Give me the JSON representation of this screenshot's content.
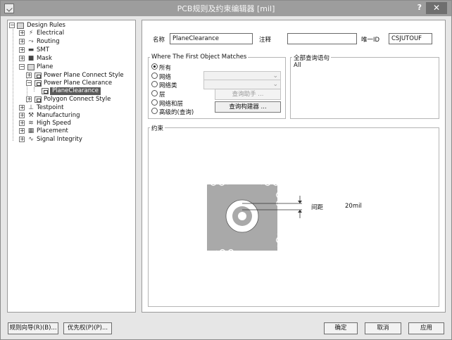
{
  "window": {
    "title": "PCB规则及约束编辑器 [mil]",
    "help_label": "?",
    "close_label": "✕"
  },
  "tree": {
    "expanders": {
      "minus": "−",
      "plus": "+"
    },
    "root": "Design Rules",
    "categories": [
      {
        "label": "Electrical"
      },
      {
        "label": "Routing"
      },
      {
        "label": "SMT"
      },
      {
        "label": "Mask"
      },
      {
        "label": "Plane"
      },
      {
        "label": "Testpoint"
      },
      {
        "label": "Manufacturing"
      },
      {
        "label": "High Speed"
      },
      {
        "label": "Placement"
      },
      {
        "label": "Signal Integrity"
      }
    ],
    "plane_children": [
      {
        "label": "Power Plane Connect Style"
      },
      {
        "label": "Power Plane Clearance"
      },
      {
        "label": "Polygon Connect Style"
      }
    ],
    "selected_rule": "PlaneClearance"
  },
  "rule": {
    "name_label": "名称",
    "name_value": "PlaneClearance",
    "comment_label": "注释",
    "comment_value": "",
    "uid_label": "唯一ID",
    "uid_value": "CSJUTOUF"
  },
  "match": {
    "title": "Where The First Object Matches",
    "options": [
      "所有",
      "网络",
      "网络类",
      "层",
      "网络和层",
      "高级的(查询)"
    ],
    "selected_index": 0,
    "query_helper_label": "查询助手 ...",
    "query_builder_label": "查询构建器 ..."
  },
  "full_query": {
    "title": "全部查询语句",
    "text": "All"
  },
  "constraints": {
    "title": "约束",
    "clearance_label": "间距",
    "clearance_value": "20mil"
  },
  "footer": {
    "wizard_label": "规则向导(R)(B)...",
    "priority_label": "优先权(P)(P)...",
    "ok_label": "确定",
    "cancel_label": "取消",
    "apply_label": "应用"
  }
}
